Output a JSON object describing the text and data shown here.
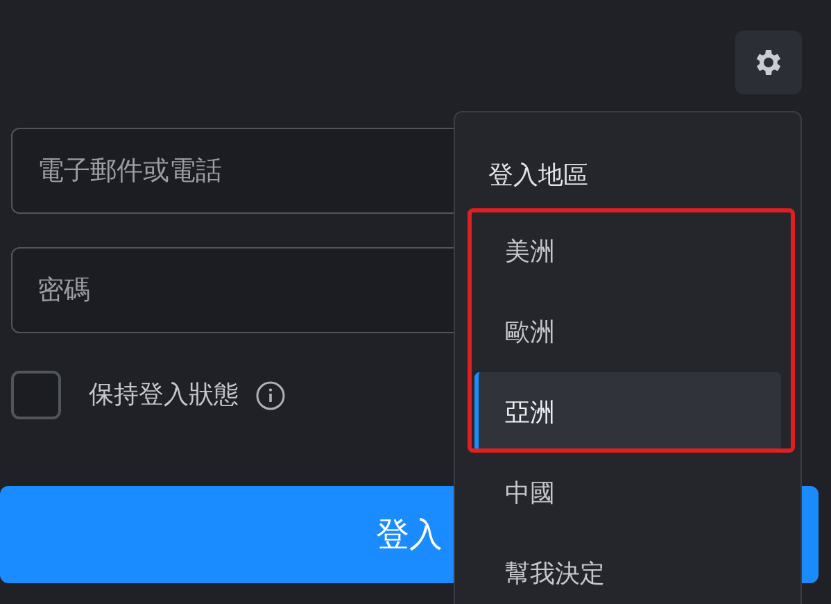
{
  "login_form": {
    "email_field": {
      "placeholder": "電子郵件或電話"
    },
    "password_field": {
      "placeholder": "密碼"
    },
    "remember_me": {
      "label": "保持登入狀態",
      "checked": false
    },
    "login_button": {
      "label": "登入"
    }
  },
  "region_menu": {
    "title": "登入地區",
    "items": [
      {
        "label": "美洲",
        "selected": false
      },
      {
        "label": "歐洲",
        "selected": false
      },
      {
        "label": "亞洲",
        "selected": true
      },
      {
        "label": "中國",
        "selected": false
      },
      {
        "label": "幫我決定",
        "selected": false
      }
    ]
  }
}
